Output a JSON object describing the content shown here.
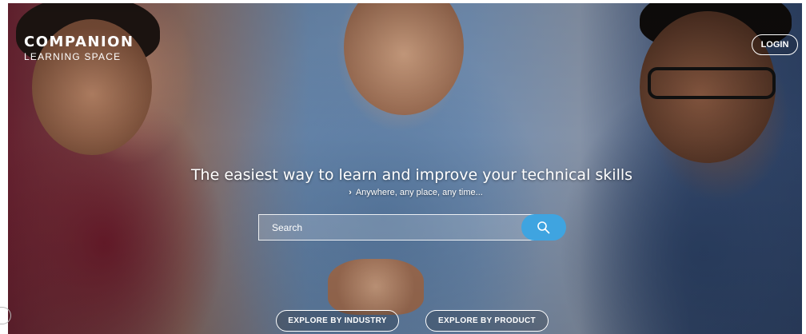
{
  "brand": {
    "name": "COMPANION",
    "tagline": "LEARNING SPACE"
  },
  "header": {
    "login_label": "LOGIN"
  },
  "hero": {
    "headline": "The easiest way to learn and improve your technical skills",
    "subline": "Anywhere, any place, any time...",
    "subline_icon": "chevron-right-icon"
  },
  "search": {
    "placeholder": "Search",
    "value": "",
    "icon": "search-icon"
  },
  "explore": {
    "industry_label": "EXPLORE BY INDUSTRY",
    "product_label": "EXPLORE BY PRODUCT"
  },
  "colors": {
    "accent": "#3fa4e0",
    "text": "#ffffff"
  }
}
